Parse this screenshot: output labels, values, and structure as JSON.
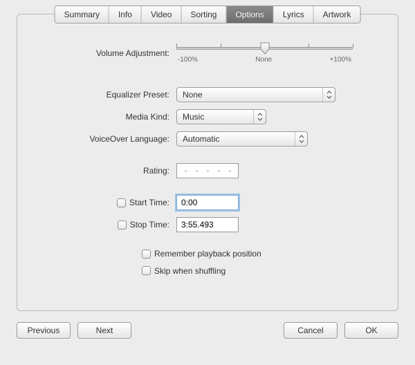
{
  "tabs": {
    "summary": "Summary",
    "info": "Info",
    "video": "Video",
    "sorting": "Sorting",
    "options": "Options",
    "lyrics": "Lyrics",
    "artwork": "Artwork"
  },
  "labels": {
    "volume_adjustment": "Volume Adjustment:",
    "equalizer_preset": "Equalizer Preset:",
    "media_kind": "Media Kind:",
    "voiceover_language": "VoiceOver Language:",
    "rating": "Rating:",
    "start_time": "Start Time:",
    "stop_time": "Stop Time:",
    "remember_playback": "Remember playback position",
    "skip_shuffle": "Skip when shuffling"
  },
  "values": {
    "equalizer_preset": "None",
    "media_kind": "Music",
    "voiceover_language": "Automatic",
    "start_time": "0:00",
    "stop_time": "3:55.493"
  },
  "slider": {
    "min_label": "-100%",
    "mid_label": "None",
    "max_label": "+100%"
  },
  "buttons": {
    "previous": "Previous",
    "next": "Next",
    "cancel": "Cancel",
    "ok": "OK"
  }
}
